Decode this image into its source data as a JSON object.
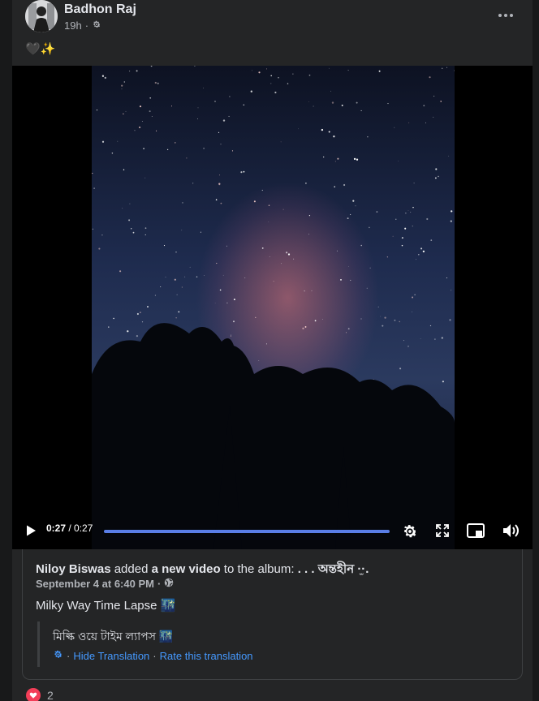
{
  "post": {
    "author": "Badhon Raj",
    "time": "19h",
    "separator": "·",
    "privacy_icon": "gear-icon",
    "text": "🖤✨",
    "more_icon": "more-horizontal-icon"
  },
  "video": {
    "current_time": "0:27",
    "time_separator": " / ",
    "duration": "0:27",
    "progress": 1.0,
    "controls": [
      "play-icon",
      "settings-gear-icon",
      "fullscreen-icon",
      "picture-in-picture-icon",
      "volume-icon"
    ]
  },
  "shared": {
    "name": "Niloy Biswas",
    "added": " added ",
    "object": "a new video",
    "to_album": " to the album: ",
    "album": ". . . অন্তহীন ·̫·.",
    "date": "September 4 at 6:40 PM",
    "date_separator": "·",
    "audience_icon": "globe-icon",
    "caption": "Milky Way Time Lapse 🌃",
    "translation": {
      "text": "মিল্কি ওয়ে টাইম ল্যাপস 🌃",
      "hide_label": "Hide Translation",
      "rate_label": "Rate this translation",
      "separator": "·"
    }
  },
  "reactions": {
    "count": "2",
    "icon": "love-reaction-icon"
  },
  "colors": {
    "background": "#18191a",
    "card": "#242526",
    "link": "#4599ff",
    "progress": "#5a7ee6",
    "love": "#f33e58"
  }
}
